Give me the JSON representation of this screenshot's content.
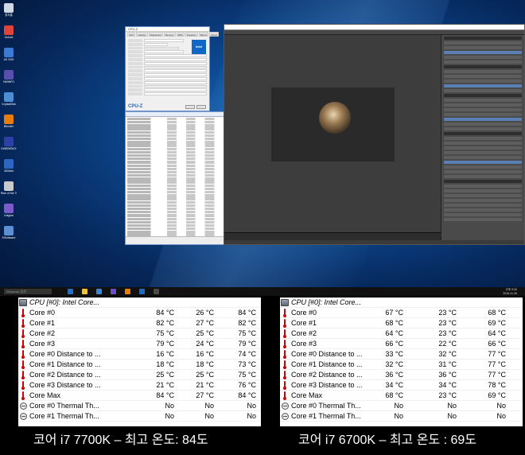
{
  "desktop": {
    "icons": [
      {
        "label": "휴지통",
        "color": "#cfd8e3"
      },
      {
        "label": "Unlock",
        "color": "#e0433a"
      },
      {
        "label": "AS SSD",
        "color": "#3a7bd5"
      },
      {
        "label": "HWiNFO",
        "color": "#5a4fb0"
      },
      {
        "label": "CrystalDisk",
        "color": "#4a8fd6"
      },
      {
        "label": "Blender",
        "color": "#e87d0d"
      },
      {
        "label": "CINEBENCH",
        "color": "#2f3fa8"
      },
      {
        "label": "3DMark",
        "color": "#2a66c2"
      },
      {
        "label": "Rise of the Tomb Raider",
        "color": "#c9c9c9"
      },
      {
        "label": "Unigine",
        "color": "#7a5bc9"
      },
      {
        "label": "SiSoftware",
        "color": "#5a8fd6"
      }
    ],
    "taskbar": {
      "search_placeholder": "Windows 검색",
      "clock_time": "오후 5:00",
      "clock_date": "2016-11-26"
    },
    "cpuz": {
      "title": "CPU-Z",
      "tabs": [
        "CPU",
        "Caches",
        "Mainboard",
        "Memory",
        "SPD",
        "Graphics",
        "Bench",
        "About"
      ],
      "brand": "CPU-Z"
    }
  },
  "panels": {
    "left": {
      "header": "CPU [#0]: Intel Core...",
      "rows": [
        {
          "icon": "thermometer",
          "name": "Core #0",
          "current": "84 °C",
          "min": "26 °C",
          "max": "84 °C"
        },
        {
          "icon": "thermometer",
          "name": "Core #1",
          "current": "82 °C",
          "min": "27 °C",
          "max": "82 °C"
        },
        {
          "icon": "thermometer",
          "name": "Core #2",
          "current": "75 °C",
          "min": "25 °C",
          "max": "75 °C"
        },
        {
          "icon": "thermometer",
          "name": "Core #3",
          "current": "79 °C",
          "min": "24 °C",
          "max": "79 °C"
        },
        {
          "icon": "thermometer",
          "name": "Core #0 Distance to ...",
          "current": "16 °C",
          "min": "16 °C",
          "max": "74 °C"
        },
        {
          "icon": "thermometer",
          "name": "Core #1 Distance to ...",
          "current": "18 °C",
          "min": "18 °C",
          "max": "73 °C"
        },
        {
          "icon": "thermometer",
          "name": "Core #2 Distance to ...",
          "current": "25 °C",
          "min": "25 °C",
          "max": "75 °C"
        },
        {
          "icon": "thermometer",
          "name": "Core #3 Distance to ...",
          "current": "21 °C",
          "min": "21 °C",
          "max": "76 °C"
        },
        {
          "icon": "thermometer",
          "name": "Core Max",
          "current": "84 °C",
          "min": "27 °C",
          "max": "84 °C"
        },
        {
          "icon": "clock",
          "name": "Core #0 Thermal Th...",
          "current": "No",
          "min": "No",
          "max": "No"
        },
        {
          "icon": "clock",
          "name": "Core #1 Thermal Th...",
          "current": "No",
          "min": "No",
          "max": "No"
        }
      ]
    },
    "right": {
      "header": "CPU [#0]: Intel Core...",
      "rows": [
        {
          "icon": "thermometer",
          "name": "Core #0",
          "current": "67 °C",
          "min": "23 °C",
          "max": "68 °C"
        },
        {
          "icon": "thermometer",
          "name": "Core #1",
          "current": "68 °C",
          "min": "23 °C",
          "max": "69 °C"
        },
        {
          "icon": "thermometer",
          "name": "Core #2",
          "current": "64 °C",
          "min": "23 °C",
          "max": "64 °C"
        },
        {
          "icon": "thermometer",
          "name": "Core #3",
          "current": "66 °C",
          "min": "22 °C",
          "max": "66 °C"
        },
        {
          "icon": "thermometer",
          "name": "Core #0 Distance to ...",
          "current": "33 °C",
          "min": "32 °C",
          "max": "77 °C"
        },
        {
          "icon": "thermometer",
          "name": "Core #1 Distance to ...",
          "current": "32 °C",
          "min": "31 °C",
          "max": "77 °C"
        },
        {
          "icon": "thermometer",
          "name": "Core #2 Distance to ...",
          "current": "36 °C",
          "min": "36 °C",
          "max": "77 °C"
        },
        {
          "icon": "thermometer",
          "name": "Core #3 Distance to ...",
          "current": "34 °C",
          "min": "34 °C",
          "max": "78 °C"
        },
        {
          "icon": "thermometer",
          "name": "Core Max",
          "current": "68 °C",
          "min": "23 °C",
          "max": "69 °C"
        },
        {
          "icon": "clock",
          "name": "Core #0 Thermal Th...",
          "current": "No",
          "min": "No",
          "max": "No"
        },
        {
          "icon": "clock",
          "name": "Core #1 Thermal Th...",
          "current": "No",
          "min": "No",
          "max": "No"
        }
      ]
    }
  },
  "captions": {
    "left": "코어 i7 7700K – 최고 온도: 84도",
    "right": "코어 i7 6700K – 최고 온도 : 69도"
  }
}
